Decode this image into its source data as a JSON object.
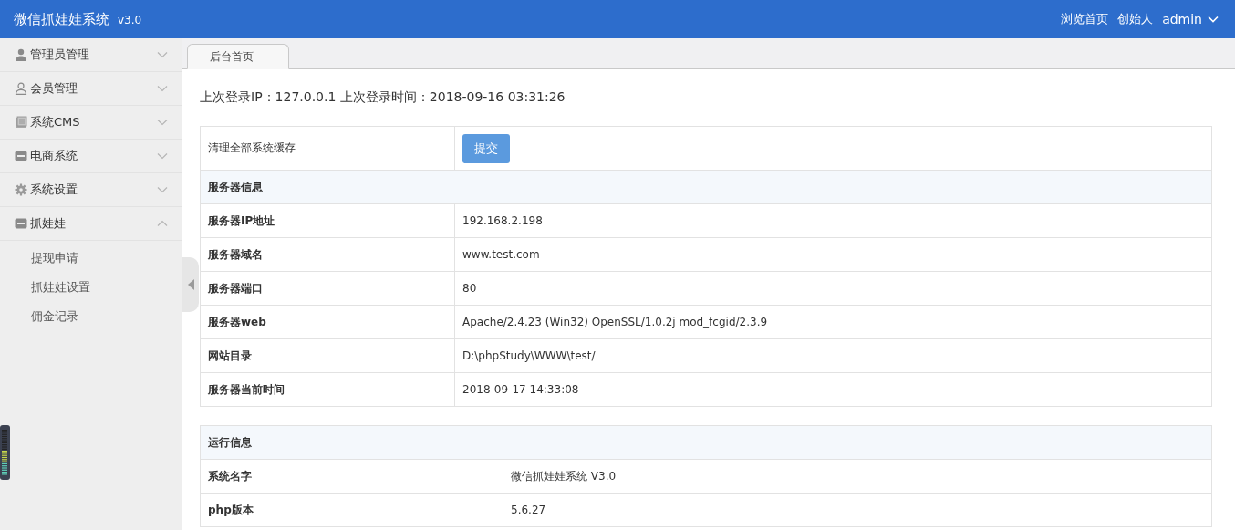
{
  "header": {
    "title": "微信抓娃娃系统",
    "version": "v3.0",
    "links": [
      "浏览首页",
      "创始人"
    ],
    "user": "admin"
  },
  "sidebar": {
    "items": [
      {
        "label": "管理员管理",
        "expanded": false
      },
      {
        "label": "会员管理",
        "expanded": false
      },
      {
        "label": "系统CMS",
        "expanded": false
      },
      {
        "label": "电商系统",
        "expanded": false
      },
      {
        "label": "系统设置",
        "expanded": false
      },
      {
        "label": "抓娃娃",
        "expanded": true,
        "children": [
          {
            "label": "提现申请"
          },
          {
            "label": "抓娃娃设置"
          },
          {
            "label": "佣金记录"
          }
        ]
      }
    ]
  },
  "tabs": [
    {
      "label": "后台首页",
      "selected": true
    }
  ],
  "login_info": "上次登录IP：127.0.0.1 上次登录时间：2018-09-16 03:31:26",
  "tables": [
    {
      "rows": [
        {
          "kind": "action",
          "label": "清理全部系统缓存",
          "button": "提交"
        },
        {
          "kind": "section",
          "label": "服务器信息"
        },
        {
          "kind": "info",
          "label": "服务器IP地址",
          "value": "192.168.2.198"
        },
        {
          "kind": "info",
          "label": "服务器域名",
          "value": "www.test.com"
        },
        {
          "kind": "info",
          "label": "服务器端口",
          "value": "80"
        },
        {
          "kind": "info",
          "label": "服务器web",
          "value": "Apache/2.4.23 (Win32) OpenSSL/1.0.2j mod_fcgid/2.3.9"
        },
        {
          "kind": "info",
          "label": "网站目录",
          "value": "D:\\phpStudy\\WWW\\test/"
        },
        {
          "kind": "info",
          "label": "服务器当前时间",
          "value": "2018-09-17 14:33:08"
        }
      ]
    },
    {
      "rows": [
        {
          "kind": "section",
          "label": "运行信息"
        },
        {
          "kind": "info",
          "label": "系统名字",
          "value": "微信抓娃娃系统 V3.0"
        },
        {
          "kind": "info",
          "label": "php版本",
          "value": "5.6.27"
        }
      ]
    }
  ]
}
